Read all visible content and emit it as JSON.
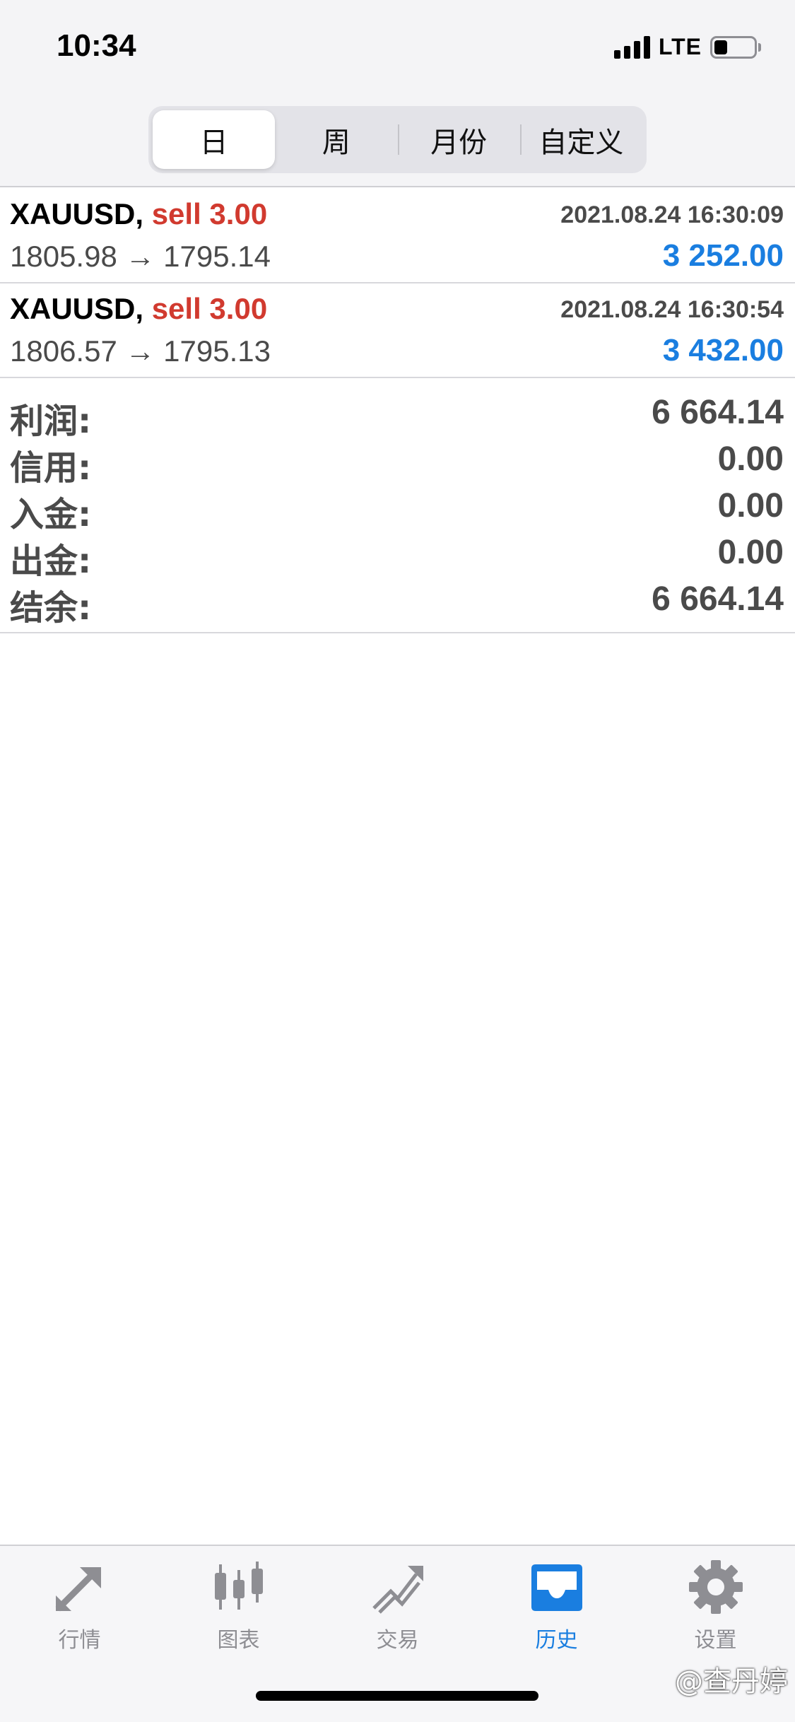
{
  "status_bar": {
    "time": "10:34",
    "network": "LTE",
    "signal_bars": 4,
    "battery_level": 0.25
  },
  "segments": [
    "日",
    "周",
    "月份",
    "自定义"
  ],
  "selected_segment": "日",
  "trades": [
    {
      "symbol": "XAUUSD,",
      "direction": "sell 3.00",
      "datetime": "2021.08.24 16:30:09",
      "prices": "1805.98 → 1795.14",
      "profit": "3 252.00"
    },
    {
      "symbol": "XAUUSD,",
      "direction": "sell 3.00",
      "datetime": "2021.08.24 16:30:54",
      "prices": "1806.57 → 1795.13",
      "profit": "3 432.00"
    }
  ],
  "summary": [
    {
      "label": "利润:",
      "value": "6 664.14"
    },
    {
      "label": "信用:",
      "value": "0.00"
    },
    {
      "label": "入金:",
      "value": "0.00"
    },
    {
      "label": "出金:",
      "value": "0.00"
    },
    {
      "label": "结余:",
      "value": "6 664.14"
    }
  ],
  "tabs": [
    {
      "label": "行情",
      "icon": "quotes-arrows-icon"
    },
    {
      "label": "图表",
      "icon": "candlestick-chart-icon"
    },
    {
      "label": "交易",
      "icon": "trade-trend-icon"
    },
    {
      "label": "历史",
      "icon": "inbox-tray-icon"
    },
    {
      "label": "设置",
      "icon": "gear-icon"
    }
  ],
  "active_tab": "历史",
  "watermark": "@查丹婷",
  "colors": {
    "sell": "#d13a2f",
    "profit": "#1a7ee0",
    "active_tab": "#1a7ee0",
    "inactive_tab": "#8e8e93"
  }
}
